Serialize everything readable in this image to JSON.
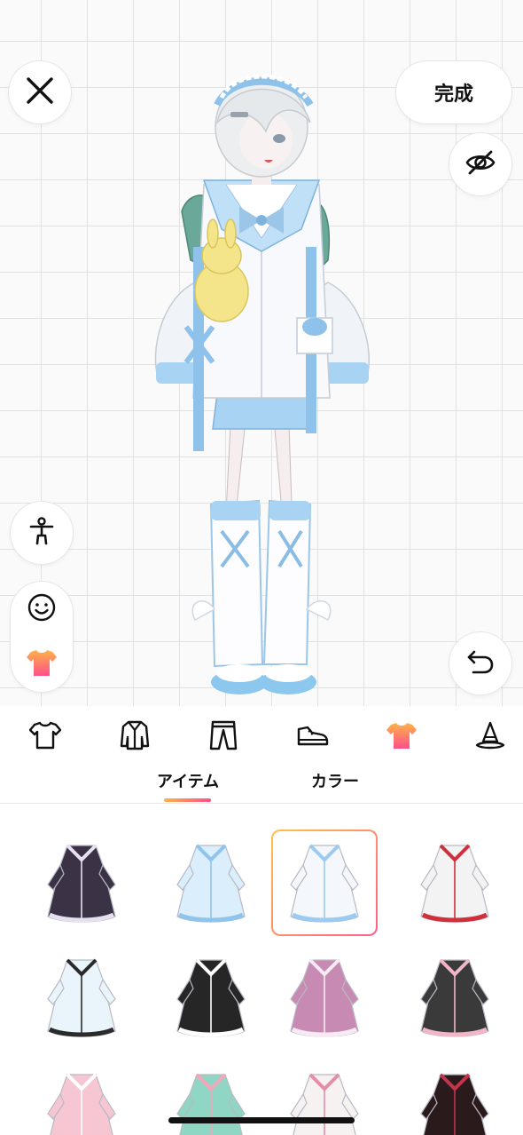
{
  "header": {
    "done_label": "完成"
  },
  "icons": {
    "close": "close-icon",
    "visibility": "eye-off-icon",
    "pose": "person-pose-icon",
    "face": "smiley-face-icon",
    "outfit": "tshirt-icon",
    "undo": "undo-arrow-icon"
  },
  "categories": [
    {
      "name": "tops",
      "icon": "tshirt-outline-icon"
    },
    {
      "name": "outerwear",
      "icon": "coat-icon"
    },
    {
      "name": "bottoms",
      "icon": "pants-icon"
    },
    {
      "name": "shoes",
      "icon": "shoe-icon"
    },
    {
      "name": "full-outfit",
      "icon": "tshirt-filled-icon",
      "active": true
    },
    {
      "name": "hat",
      "icon": "witch-hat-icon"
    }
  ],
  "tabs": {
    "items_label": "アイテム",
    "color_label": "カラー"
  },
  "colors": {
    "accent_start": "#ffb347",
    "accent_end": "#ff4f8b",
    "grid_line": "#e2e2e2"
  },
  "items": [
    {
      "name": "dark-starry-lolita-dress",
      "main": "#3b3246",
      "trim": "#e6e0f0",
      "selected": false
    },
    {
      "name": "light-blue-white-jacket",
      "main": "#dbeefb",
      "trim": "#8fc4ec",
      "selected": false
    },
    {
      "name": "blue-sailor-hoodie",
      "main": "#f4f8fc",
      "trim": "#9ccaf0",
      "selected": true
    },
    {
      "name": "white-red-nurse-dress",
      "main": "#f3f3f3",
      "trim": "#d0303c",
      "selected": false
    },
    {
      "name": "white-blue-gown-with-staff",
      "main": "#eaf4fb",
      "trim": "#2b2b2b",
      "selected": false
    },
    {
      "name": "black-white-maid-dress",
      "main": "#262626",
      "trim": "#ffffff",
      "selected": false
    },
    {
      "name": "pink-heart-dress",
      "main": "#c78ab3",
      "trim": "#f7eaf2",
      "selected": false
    },
    {
      "name": "black-heart-dress",
      "main": "#3a3a3a",
      "trim": "#f0b7c8",
      "selected": false
    },
    {
      "name": "pink-frill-dress",
      "main": "#f6c6d2",
      "trim": "#ffffff",
      "selected": false
    },
    {
      "name": "mint-pink-frill-dress",
      "main": "#8fd6c4",
      "trim": "#f4a6bb",
      "selected": false
    },
    {
      "name": "white-pink-frill-dress",
      "main": "#f7f2f2",
      "trim": "#e58fa6",
      "selected": false
    },
    {
      "name": "black-red-gothic-dress",
      "main": "#2a1a1c",
      "trim": "#c2344a",
      "selected": false
    }
  ]
}
